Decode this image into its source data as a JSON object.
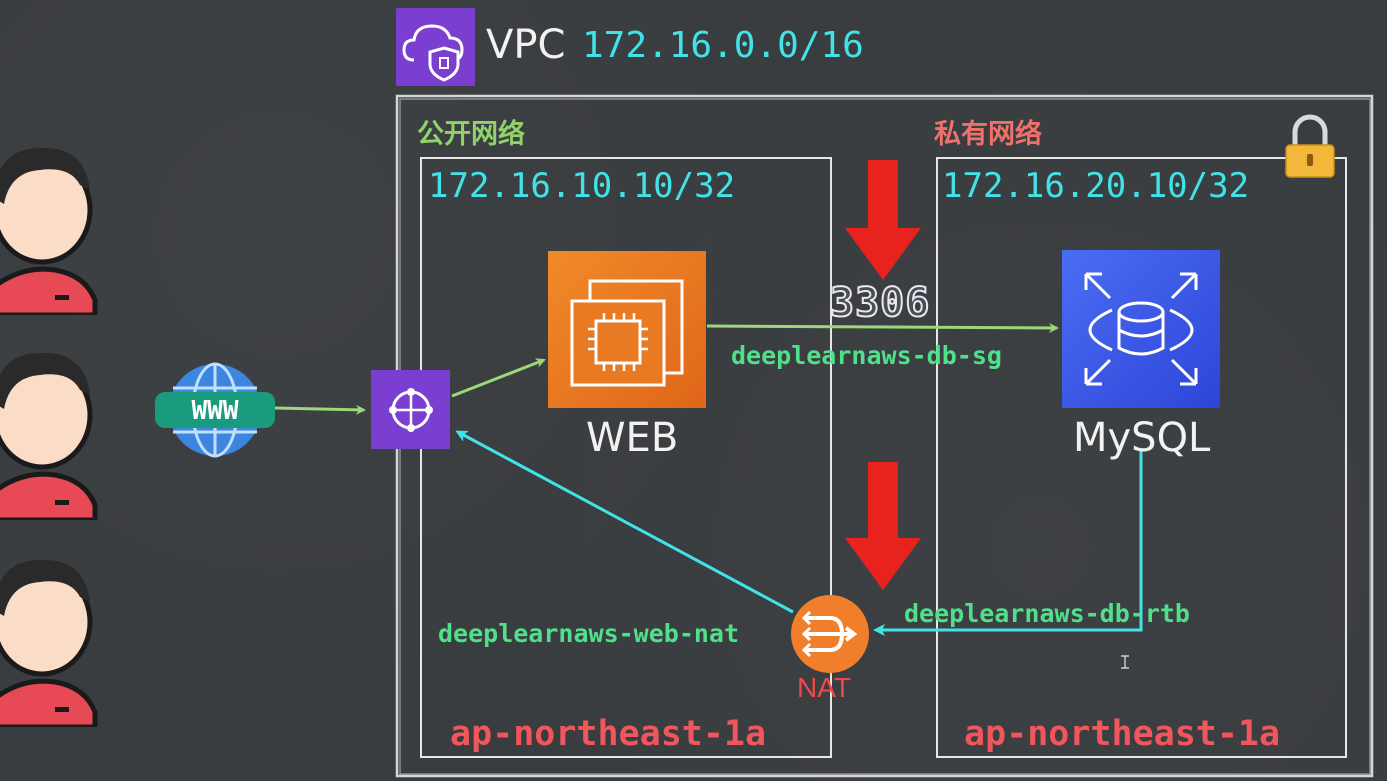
{
  "vpc": {
    "label": "VPC",
    "cidr": "172.16.0.0/16",
    "icon": "vpc-shield-cloud-icon"
  },
  "public_subnet": {
    "label": "公开网络",
    "cidr": "172.16.10.10/32",
    "az": "ap-northeast-1a"
  },
  "private_subnet": {
    "label": "私有网络",
    "cidr": "172.16.20.10/32",
    "az": "ap-northeast-1a",
    "icon": "padlock-icon"
  },
  "internet": {
    "label": "WWW",
    "icon": "globe-icon"
  },
  "gateway": {
    "icon": "internet-gateway-icon"
  },
  "web": {
    "label": "WEB",
    "icon": "ec2-instance-icon"
  },
  "db": {
    "label": "MySQL",
    "icon": "rds-database-icon"
  },
  "connections": {
    "port": "3306",
    "security_group": "deeplearnaws-db-sg",
    "route_table": "deeplearnaws-db-rtb",
    "nat_gateway": "deeplearnaws-web-nat"
  },
  "nat": {
    "label": "NAT",
    "icon": "nat-gateway-icon"
  },
  "users": {
    "icon": "user-avatar-icon",
    "count": 3
  },
  "colors": {
    "background": "#3a3d40",
    "cyan": "#42e3e8",
    "green": "#4fe08a",
    "red": "#f0565c",
    "aws_orange": "#f08a28",
    "aws_blue": "#3b58e4",
    "aws_purple": "#7a3fd0"
  }
}
